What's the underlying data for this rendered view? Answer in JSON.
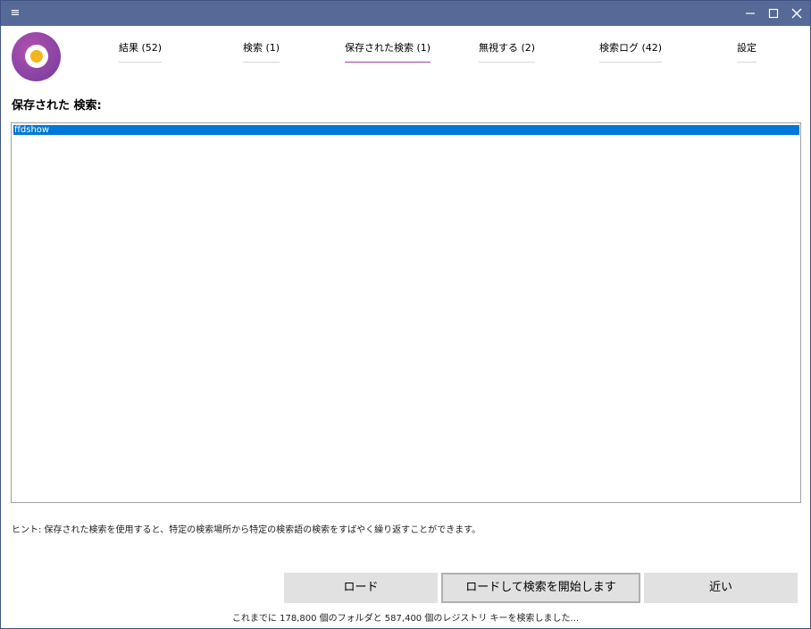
{
  "titlebar": {
    "menu_glyph": "≡",
    "icons": [
      "menu-icon",
      "minimize-icon",
      "maximize-icon",
      "close-icon"
    ]
  },
  "tabs": [
    {
      "label": "結果 (52)",
      "active": false
    },
    {
      "label": "検索 (1)",
      "active": false
    },
    {
      "label": "保存された検索 (1)",
      "active": true
    },
    {
      "label": "無視する (2)",
      "active": false
    },
    {
      "label": "検索ログ (42)",
      "active": false
    },
    {
      "label": "設定",
      "active": false
    }
  ],
  "saved_searches": {
    "title": "保存された 検索:",
    "items": [
      {
        "label": "ffdshow",
        "selected": true
      }
    ]
  },
  "hint": "ヒント: 保存された検索を使用すると、特定の検索場所から特定の検索語の検索をすばやく繰り返すことができます。",
  "buttons": {
    "load": "ロード",
    "load_and_search": "ロードして検索を開始します",
    "close": "近い"
  },
  "status": "これまでに 178,800 個のフォルダと 587,400 個のレジストリ キーを検索しました...",
  "colors": {
    "titlebar": "#566a97",
    "accent_tab": "#a23fa8",
    "selection": "#0078d7",
    "logo_purple": "#8e46a6",
    "logo_yellow": "#f2b51c"
  }
}
